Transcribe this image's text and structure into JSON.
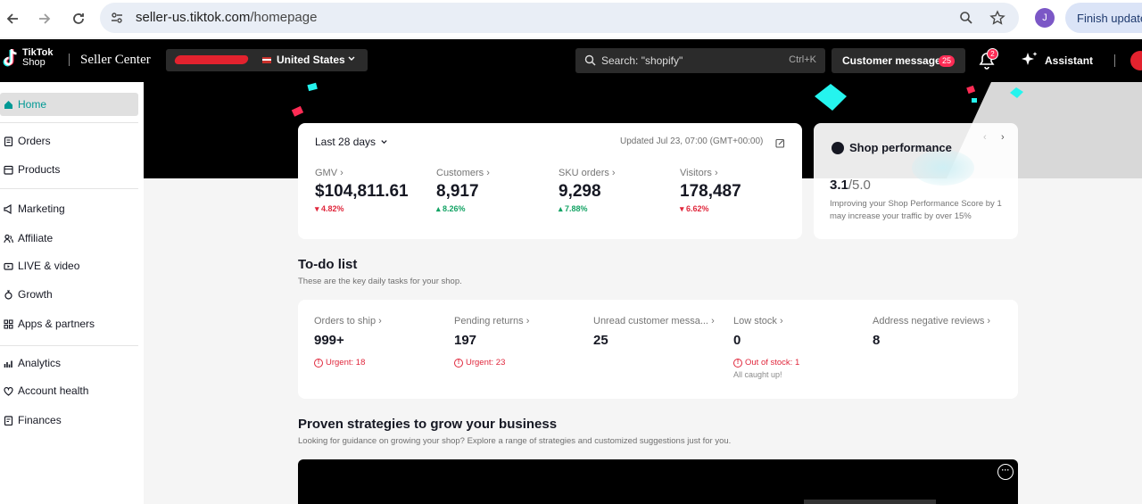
{
  "browser": {
    "url_host": "seller-us.tiktok.com",
    "url_path": "/homepage",
    "profile_initial": "J",
    "finish_update": "Finish update"
  },
  "header": {
    "logo_line1": "TikTok",
    "logo_line2": "Shop",
    "app_title": "Seller Center",
    "region": "United States",
    "search_placeholder": "Search: \"shopify\"",
    "search_shortcut": "Ctrl+K",
    "messages_label": "Customer messages",
    "messages_count": "25",
    "notifications_count": "2",
    "assistant_label": "Assistant"
  },
  "sidebar": {
    "items": [
      {
        "label": "Home",
        "icon": "home-icon"
      },
      {
        "label": "Orders",
        "icon": "orders-icon"
      },
      {
        "label": "Products",
        "icon": "products-icon"
      },
      {
        "label": "Marketing",
        "icon": "megaphone-icon"
      },
      {
        "label": "Affiliate",
        "icon": "people-icon"
      },
      {
        "label": "LIVE & video",
        "icon": "video-icon"
      },
      {
        "label": "Growth",
        "icon": "growth-icon"
      },
      {
        "label": "Apps & partners",
        "icon": "apps-icon"
      },
      {
        "label": "Analytics",
        "icon": "analytics-icon"
      },
      {
        "label": "Account health",
        "icon": "health-icon"
      },
      {
        "label": "Finances",
        "icon": "finances-icon"
      }
    ]
  },
  "kpi": {
    "range": "Last 28 days",
    "updated": "Updated Jul 23, 07:00 (GMT+00:00)",
    "metrics": [
      {
        "label": "GMV",
        "value": "$104,811.61",
        "change": "4.82%",
        "direction": "down"
      },
      {
        "label": "Customers",
        "value": "8,917",
        "change": "8.26%",
        "direction": "up"
      },
      {
        "label": "SKU orders",
        "value": "9,298",
        "change": "7.88%",
        "direction": "up"
      },
      {
        "label": "Visitors",
        "value": "178,487",
        "change": "6.62%",
        "direction": "down"
      }
    ]
  },
  "performance": {
    "title": "Shop performance",
    "score": "3.1",
    "score_total": "/5.0",
    "description": "Improving your Shop Performance Score by 1 may increase your traffic by over 15%"
  },
  "todo": {
    "title": "To-do list",
    "subtitle": "These are the key daily tasks for your shop.",
    "items": [
      {
        "label": "Orders to ship",
        "value": "999+",
        "alert": "Urgent: 18",
        "note": ""
      },
      {
        "label": "Pending returns",
        "value": "197",
        "alert": "Urgent: 23",
        "note": ""
      },
      {
        "label": "Unread customer messa...",
        "value": "25",
        "alert": "",
        "note": ""
      },
      {
        "label": "Low stock",
        "value": "0",
        "alert": "Out of stock: 1",
        "note": "All caught up!"
      },
      {
        "label": "Address negative reviews",
        "value": "8",
        "alert": "",
        "note": ""
      }
    ]
  },
  "strategies": {
    "title": "Proven strategies to grow your business",
    "subtitle": "Looking for guidance on growing your shop? Explore a range of strategies and customized suggestions just for you."
  },
  "colors": {
    "accent": "#009995",
    "negative": "#e0273c",
    "positive": "#13a364",
    "badge": "#fe2c55"
  }
}
